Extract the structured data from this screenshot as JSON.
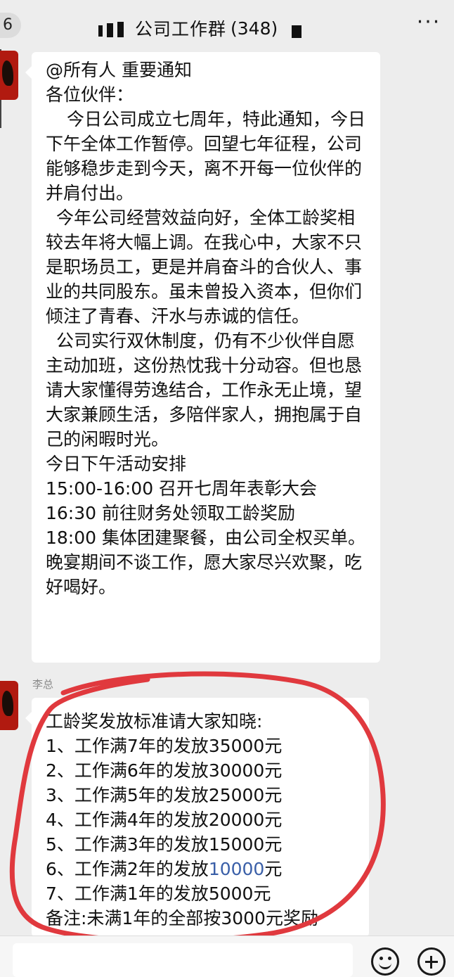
{
  "header": {
    "back_badge": "6",
    "group_title": "公司工作群",
    "member_count": "(348)",
    "more_icon": "more-dots-icon"
  },
  "messages": [
    {
      "lines": [
        "@所有人 重要通知",
        "各位伙伴：",
        "今日公司成立七周年，特此通知，今日下午全体工作暂停。回望七年征程，公司能够稳步走到今天，离不开每一位伙伴的并肩付出。",
        "今年公司经营效益向好，全体工龄奖相较去年将大幅上调。在我心中，大家不只是职场员工，更是并肩奋斗的合伙人、事业的共同股东。虽未曾投入资本，但你们倾注了青春、汗水与赤诚的信任。",
        "公司实行双休制度，仍有不少伙伴自愿主动加班，这份热忱我十分动容。但也恳请大家懂得劳逸结合，工作永无止境，望大家兼顾生活，多陪伴家人，拥抱属于自己的闲暇时光。",
        "今日下午活动安排",
        "15:00-16:00 召开七周年表彰大会",
        "16:30 前往财务处领取工龄奖励",
        "18:00 集体团建聚餐，由公司全权买单。",
        "晚宴期间不谈工作，愿大家尽兴欢聚，吃好喝好。"
      ]
    },
    {
      "sender": "李总",
      "heading": "工龄奖发放标准请大家知晓:",
      "items": [
        {
          "prefix": "1、工作满7年的发放",
          "amount": "35000",
          "suffix": "元"
        },
        {
          "prefix": "2、工作满6年的发放",
          "amount": "30000",
          "suffix": "元"
        },
        {
          "prefix": "3、工作满5年的发放",
          "amount": "25000",
          "suffix": "元"
        },
        {
          "prefix": "4、工作满4年的发放",
          "amount": "20000",
          "suffix": "元"
        },
        {
          "prefix": "5、工作满3年的发放",
          "amount": "15000",
          "suffix": "元"
        },
        {
          "prefix": "6、工作满2年的发放",
          "amount": "10000",
          "suffix": "元"
        },
        {
          "prefix": "7、工作满1年的发放",
          "amount": "5000",
          "suffix": "元"
        }
      ],
      "note": "备注:未满1年的全部按3000元奖励"
    }
  ],
  "colors": {
    "background": "#ededed",
    "bubble": "#ffffff",
    "highlight_text": "#3a5fa8",
    "annotation_red": "#e0393e"
  },
  "input_bar": {
    "emoji_icon": "emoji-icon",
    "plus_icon": "plus-icon"
  }
}
